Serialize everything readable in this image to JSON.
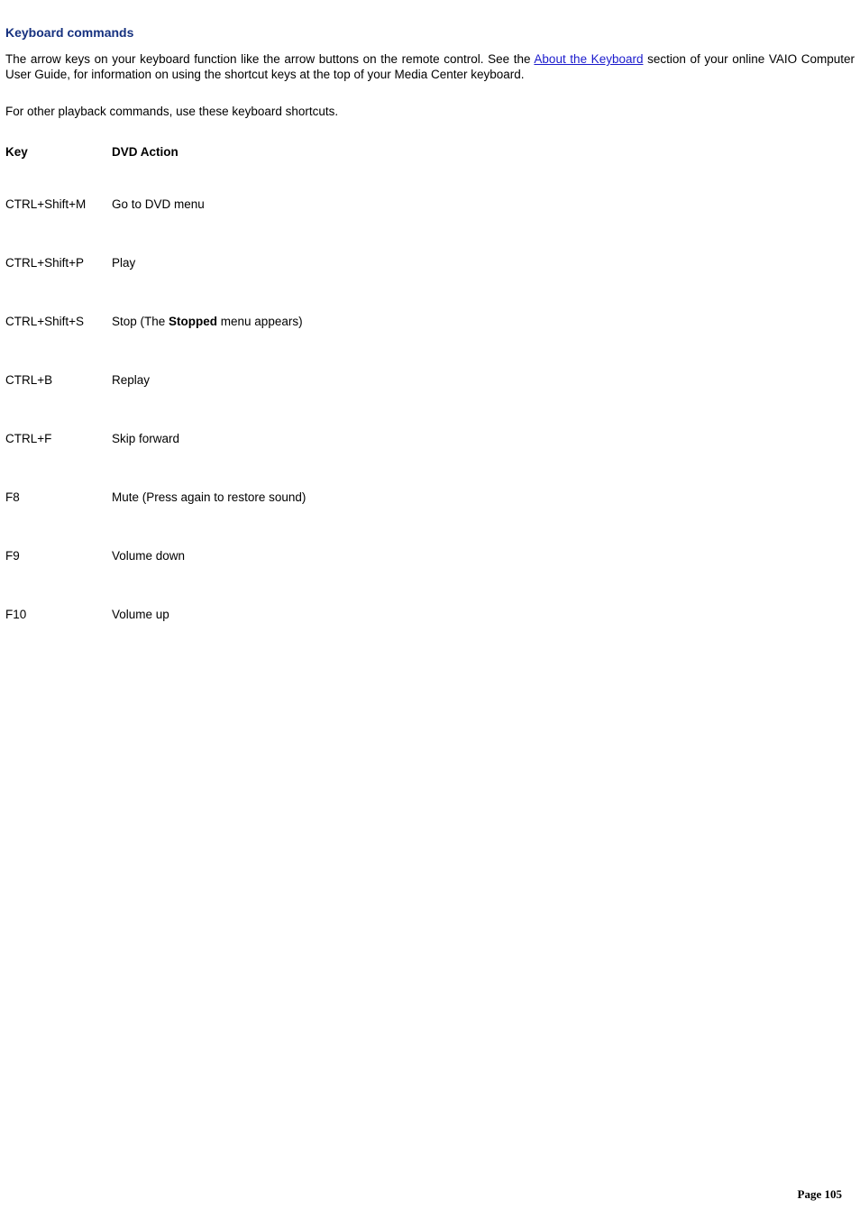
{
  "heading": "Keyboard commands",
  "intro": {
    "part1": "The arrow keys on your keyboard function like the arrow buttons on the remote control. See the ",
    "link_text": "About the Keyboard",
    "part2": " section of your online VAIO Computer User Guide, for information on using the shortcut keys at the top of your Media Center keyboard."
  },
  "subtext": "For other playback commands, use these keyboard shortcuts.",
  "columns": {
    "key": "Key",
    "action": "DVD Action"
  },
  "rows": {
    "r0": {
      "key": "CTRL+Shift+M",
      "action": "Go to DVD menu"
    },
    "r1": {
      "key": "CTRL+Shift+P",
      "action": "Play"
    },
    "r2": {
      "key": "CTRL+Shift+S",
      "action_pre": "Stop (The ",
      "action_bold": "Stopped",
      "action_post": " menu appears)"
    },
    "r3": {
      "key": "CTRL+B",
      "action": "Replay"
    },
    "r4": {
      "key": "CTRL+F",
      "action": "Skip forward"
    },
    "r5": {
      "key": "F8",
      "action": "Mute (Press again to restore sound)"
    },
    "r6": {
      "key": "F9",
      "action": "Volume down"
    },
    "r7": {
      "key": "F10",
      "action": "Volume up"
    }
  },
  "footer": "Page 105"
}
